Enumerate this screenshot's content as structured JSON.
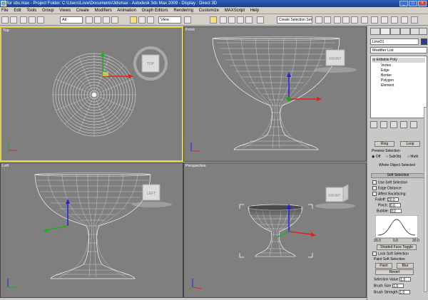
{
  "window": {
    "title": "for sbs.max - Project Folder: C:\\Users\\Love\\Documents\\3dsmax - Autodesk 3ds Max 2009 - Display : Direct 3D"
  },
  "menu": [
    "File",
    "Edit",
    "Tools",
    "Group",
    "Views",
    "Create",
    "Modifiers",
    "Animation",
    "Graph Editors",
    "Rendering",
    "Customize",
    "MAXScript",
    "Help"
  ],
  "toolbar": {
    "filter": "All",
    "ref_coord": "View",
    "selection_set": "Create Selection Set"
  },
  "viewports": {
    "top": {
      "label": "Top",
      "cube": "TOP"
    },
    "front": {
      "label": "Front",
      "cube": "FRONT"
    },
    "left": {
      "label": "Left",
      "cube": "LEFT"
    },
    "perspective": {
      "label": "Perspective",
      "cube": "FRONT"
    }
  },
  "panel": {
    "object_name": "Line01",
    "modifier_list": "Modifier List",
    "stack": [
      "Editable Poly",
      "Vertex",
      "Edge",
      "Border",
      "Polygon",
      "Element"
    ],
    "ring": "Ring",
    "loop": "Loop",
    "preview_selection": "Preview Selection",
    "preview_options": [
      "Off",
      "SubObj",
      "Multi"
    ],
    "whole_object": "Whole Object Selected",
    "soft_selection": "Soft Selection",
    "use_soft": "Use Soft Selection",
    "edge_distance": "Edge Distance:",
    "affect_backfacing": "Affect Backfacing",
    "falloff": "Falloff:",
    "falloff_val": "20.0",
    "pinch": "Pinch:",
    "pinch_val": "0.0",
    "bubble": "Bubble:",
    "bubble_val": "0.0",
    "curve_left": "20.0",
    "curve_mid": "0.0",
    "curve_right": "20.0",
    "shaded_face": "Shaded Face Toggle",
    "lock_soft": "Lock Soft Selection",
    "paint_soft": "Paint Soft Selection",
    "paint": "Paint",
    "blur": "Blur",
    "revert": "Revert",
    "sel_value": "Selection Value",
    "sel_value_val": "1.0",
    "brush_size": "Brush Size",
    "brush_size_val": "1.0",
    "brush_strength": "Brush Strength",
    "brush_strength_val": "1.0"
  },
  "colors": {
    "active_border": "#e0d050",
    "viewport_bg": "#7f7f7f",
    "wire": "#ffffff"
  }
}
